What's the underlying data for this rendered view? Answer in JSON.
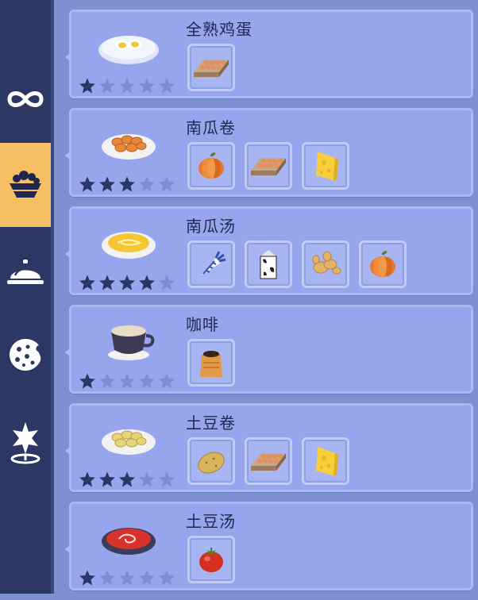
{
  "sidebar": {
    "items": [
      {
        "icon": "infinity-icon",
        "active": false
      },
      {
        "icon": "salad-bowl-icon",
        "active": true
      },
      {
        "icon": "cloche-icon",
        "active": false
      },
      {
        "icon": "cookie-icon",
        "active": false
      },
      {
        "icon": "star-location-icon",
        "active": false
      }
    ]
  },
  "colors": {
    "active_tab": "#f6bf63",
    "sidebar": "#2c3763",
    "card": "#97a6ec",
    "star_filled": "#2b3566",
    "star_empty": "#7d8cd4"
  },
  "recipes": [
    {
      "name": "全熟鸡蛋",
      "rating": 1,
      "max_rating": 5,
      "dish": "fried-egg-dish",
      "ingredients": [
        "egg-tray-icon"
      ]
    },
    {
      "name": "南瓜卷",
      "rating": 3,
      "max_rating": 5,
      "dish": "pumpkin-rolls-dish",
      "ingredients": [
        "pumpkin-icon",
        "egg-tray-icon",
        "cheese-icon"
      ]
    },
    {
      "name": "南瓜汤",
      "rating": 4,
      "max_rating": 5,
      "dish": "pumpkin-soup-dish",
      "ingredients": [
        "carrot-icon",
        "milk-carton-icon",
        "ginger-icon",
        "pumpkin-icon"
      ]
    },
    {
      "name": "咖啡",
      "rating": 1,
      "max_rating": 5,
      "dish": "coffee-cup-dish",
      "ingredients": [
        "coffee-bean-bag-icon"
      ]
    },
    {
      "name": "土豆卷",
      "rating": 3,
      "max_rating": 5,
      "dish": "potato-rolls-dish",
      "ingredients": [
        "potato-icon",
        "egg-tray-icon",
        "cheese-icon"
      ]
    },
    {
      "name": "土豆汤",
      "rating": 1,
      "max_rating": 5,
      "dish": "tomato-soup-dish",
      "ingredients": [
        "tomato-icon"
      ]
    }
  ]
}
